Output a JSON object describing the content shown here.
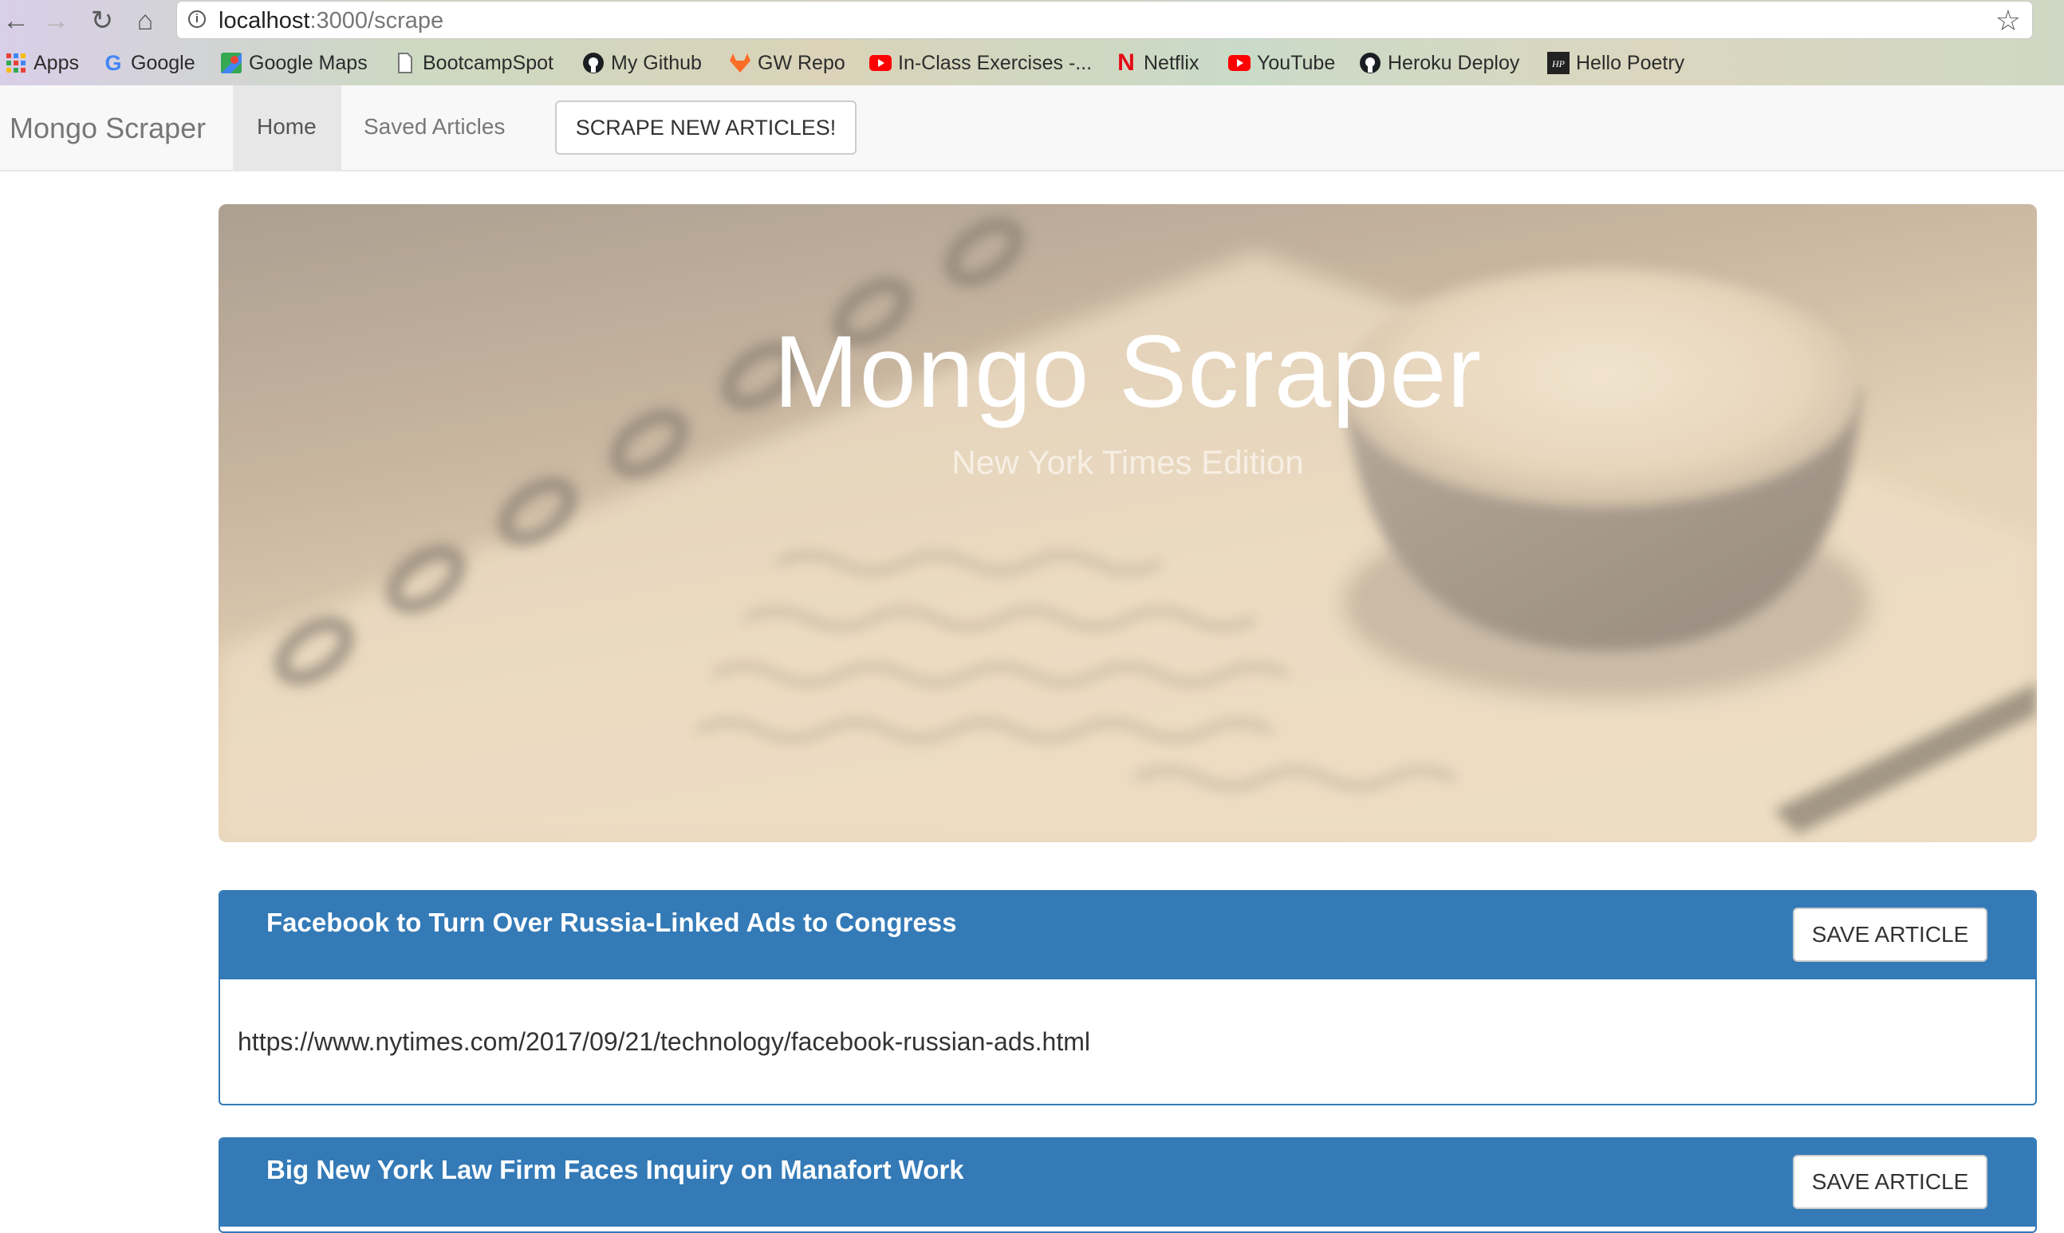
{
  "browser": {
    "url_host": "localhost",
    "url_path": ":3000/scrape",
    "bookmarks": [
      {
        "label": "Apps",
        "icon": "apps-grid-icon"
      },
      {
        "label": "Google",
        "icon": "google-icon"
      },
      {
        "label": "Google Maps",
        "icon": "maps-icon"
      },
      {
        "label": "BootcampSpot",
        "icon": "page-icon"
      },
      {
        "label": "My Github",
        "icon": "github-icon"
      },
      {
        "label": "GW Repo",
        "icon": "gitlab-icon"
      },
      {
        "label": "In-Class Exercises -...",
        "icon": "youtube-icon"
      },
      {
        "label": "Netflix",
        "icon": "netflix-icon"
      },
      {
        "label": "YouTube",
        "icon": "youtube-icon"
      },
      {
        "label": "Heroku Deploy",
        "icon": "github-icon"
      },
      {
        "label": "Hello Poetry",
        "icon": "hp-icon"
      }
    ]
  },
  "navbar": {
    "brand": "Mongo Scraper",
    "home": "Home",
    "saved": "Saved Articles",
    "scrape_button": "SCRAPE NEW ARTICLES!"
  },
  "jumbotron": {
    "title": "Mongo Scraper",
    "subtitle": "New York Times Edition"
  },
  "articles": [
    {
      "title": "Facebook to Turn Over Russia-Linked Ads to Congress",
      "url": "https://www.nytimes.com/2017/09/21/technology/facebook-russian-ads.html",
      "button": "SAVE ARTICLE"
    },
    {
      "title": "Big New York Law Firm Faces Inquiry on Manafort Work",
      "url": "",
      "button": "SAVE ARTICLE"
    }
  ],
  "colors": {
    "primary": "#337ab7",
    "navbar_bg": "#f8f8f8",
    "active_nav": "#e7e7e7"
  }
}
